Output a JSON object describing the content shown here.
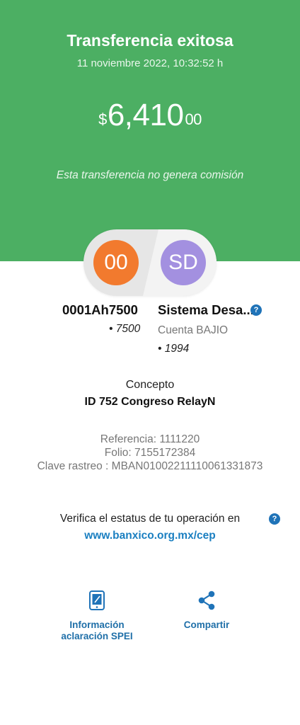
{
  "header": {
    "title": "Transferencia exitosa",
    "datetime": "11 noviembre 2022, 10:32:52 h",
    "amount": {
      "currency": "$",
      "integer": "6,410",
      "cents": "00"
    },
    "note": "Esta transferencia no genera comisión",
    "background_color": "#4caf63"
  },
  "sender": {
    "initials": "00",
    "name": "0001Ah7500",
    "account": "• 7500",
    "avatar_color": "#f27a2e"
  },
  "recipient": {
    "initials": "SD",
    "name": "Sistema Desa...",
    "bank": "Cuenta BAJIO",
    "account": "• 1994",
    "avatar_color": "#a390e0",
    "help_icon": "?"
  },
  "concept": {
    "label": "Concepto",
    "value": "ID 752 Congreso RelayN"
  },
  "references": {
    "referencia": "Referencia: 1111220",
    "folio": "Folio: 7155172384",
    "clave": "Clave rastreo : MBAN01002211110061331873"
  },
  "verify": {
    "text": "Verifica el estatus de tu operación en",
    "link": "www.banxico.org.mx/cep",
    "help_icon": "?"
  },
  "actions": {
    "info_line1": "Información",
    "info_line2": "aclaración SPEI",
    "share": "Compartir",
    "icon_color": "#1f73b8"
  }
}
